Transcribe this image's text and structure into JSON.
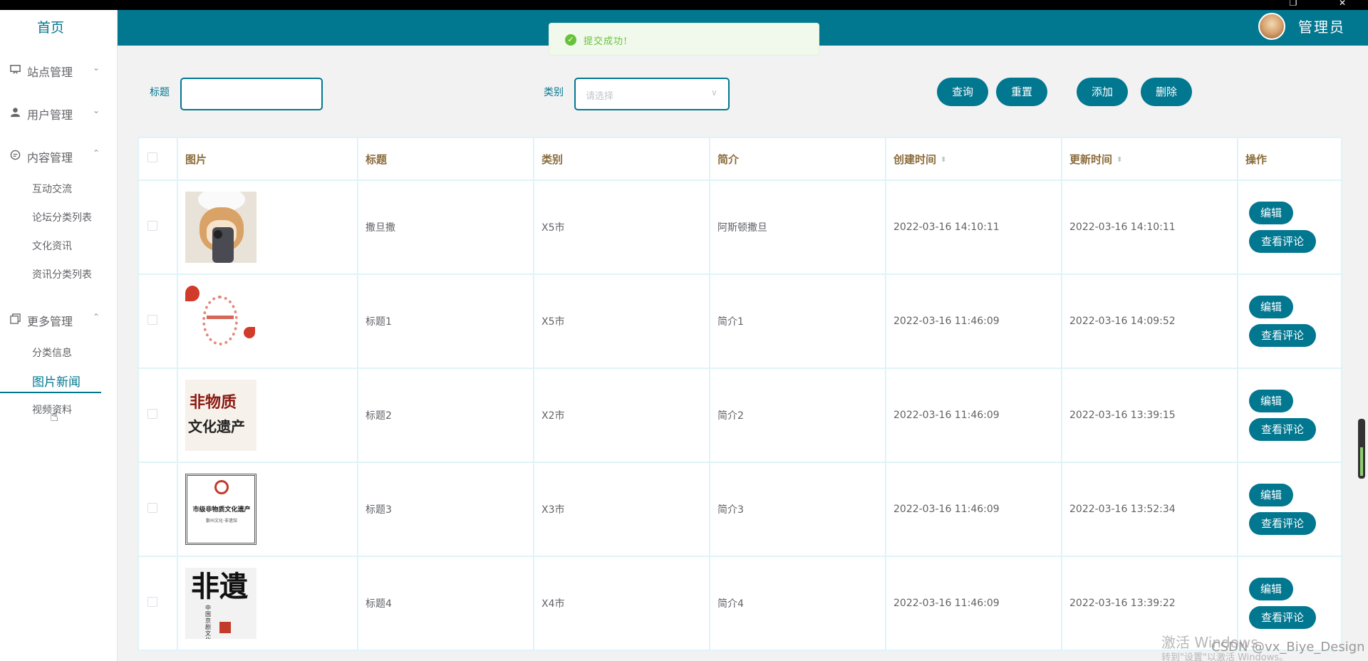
{
  "window": {
    "restore_glyph": "❐",
    "close_glyph": "✕"
  },
  "header": {
    "admin_name": "管理员"
  },
  "toast": {
    "message": "提交成功!"
  },
  "sidebar": {
    "home": "首页",
    "groups": [
      {
        "label": "站点管理",
        "icon": "monitor-icon",
        "chevron": "⌄"
      },
      {
        "label": "用户管理",
        "icon": "user-icon",
        "chevron": "⌄"
      },
      {
        "label": "内容管理",
        "icon": "chat-icon",
        "chevron": "⌃"
      },
      {
        "label": "更多管理",
        "icon": "copy-icon",
        "chevron": "⌃"
      }
    ],
    "content_items": [
      "互动交流",
      "论坛分类列表",
      "文化资讯",
      "资讯分类列表"
    ],
    "more_items": [
      "分类信息",
      "图片新闻",
      "视频资料"
    ]
  },
  "filters": {
    "title_label": "标题",
    "title_value": "",
    "category_label": "类别",
    "category_placeholder": "请选择"
  },
  "buttons": {
    "search": "查询",
    "reset": "重置",
    "add": "添加",
    "delete": "删除"
  },
  "table": {
    "headers": [
      "图片",
      "标题",
      "类别",
      "简介",
      "创建时间",
      "更新时间",
      "操作"
    ],
    "rows": [
      {
        "title": "撒旦撒",
        "category": "X5市",
        "intro": "阿斯顿撒旦",
        "created": "2022-03-16 14:10:11",
        "updated": "2022-03-16 14:10:11"
      },
      {
        "title": "标题1",
        "category": "X5市",
        "intro": "简介1",
        "created": "2022-03-16 11:46:09",
        "updated": "2022-03-16 14:09:52"
      },
      {
        "title": "标题2",
        "category": "X2市",
        "intro": "简介2",
        "created": "2022-03-16 11:46:09",
        "updated": "2022-03-16 13:39:15"
      },
      {
        "title": "标题3",
        "category": "X3市",
        "intro": "简介3",
        "created": "2022-03-16 11:46:09",
        "updated": "2022-03-16 13:52:34"
      },
      {
        "title": "标题4",
        "category": "X4市",
        "intro": "简介4",
        "created": "2022-03-16 11:46:09",
        "updated": "2022-03-16 13:39:22"
      }
    ],
    "edit_label": "编辑",
    "view_comments_label": "查看评论"
  },
  "watermark": {
    "line1": "激活 Windows",
    "line2": "转到\"设置\"以激活 Windows。",
    "csdn": "CSDN @vx_Biye_Design"
  },
  "thumb_text": {
    "row3_a": "非物质",
    "row3_b": "文化遗产",
    "row4_a": "市级非物质文化遗产",
    "row4_b": "鄞州文化·非遗馆",
    "row5_big": "非遺",
    "row5_small": "中国京剧文化"
  }
}
